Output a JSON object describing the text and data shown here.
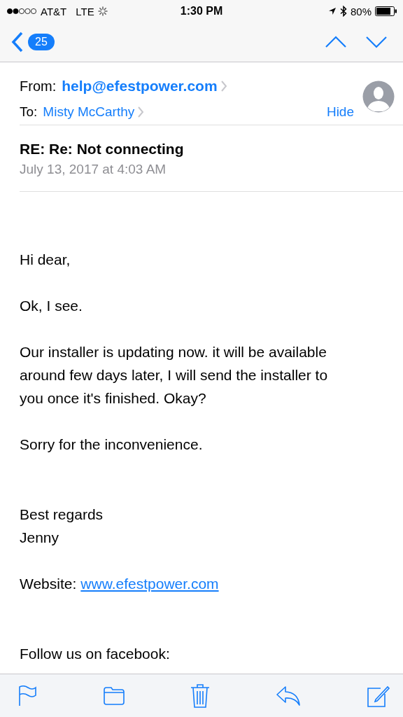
{
  "status_bar": {
    "carrier": "AT&T",
    "network": "LTE",
    "time": "1:30 PM",
    "battery": "80%"
  },
  "nav": {
    "back_count": "25"
  },
  "header": {
    "from_label": "From:",
    "from": "help@efestpower.com",
    "to_label": "To:",
    "to": "Misty McCarthy",
    "hide": "Hide"
  },
  "subject": "RE: Re: Not connecting",
  "date": "July 13, 2017 at 4:03 AM",
  "body": [
    {
      "kind": "text",
      "lines": [
        "Hi dear,"
      ]
    },
    {
      "kind": "text",
      "lines": [
        "Ok, I see."
      ]
    },
    {
      "kind": "text",
      "lines": [
        "Our installer is updating now. it will be available",
        "around few days later, I will send the installer to",
        "you once it's finished. Okay?"
      ]
    },
    {
      "kind": "text",
      "lines": [
        "Sorry for the inconvenience."
      ]
    },
    {
      "kind": "text",
      "lines": [
        "Best regards",
        "Jenny"
      ]
    },
    {
      "kind": "link",
      "label": "Website:",
      "link": "www.efestpower.com"
    },
    {
      "kind": "text",
      "lines": [
        "Follow us on facebook:"
      ]
    }
  ]
}
